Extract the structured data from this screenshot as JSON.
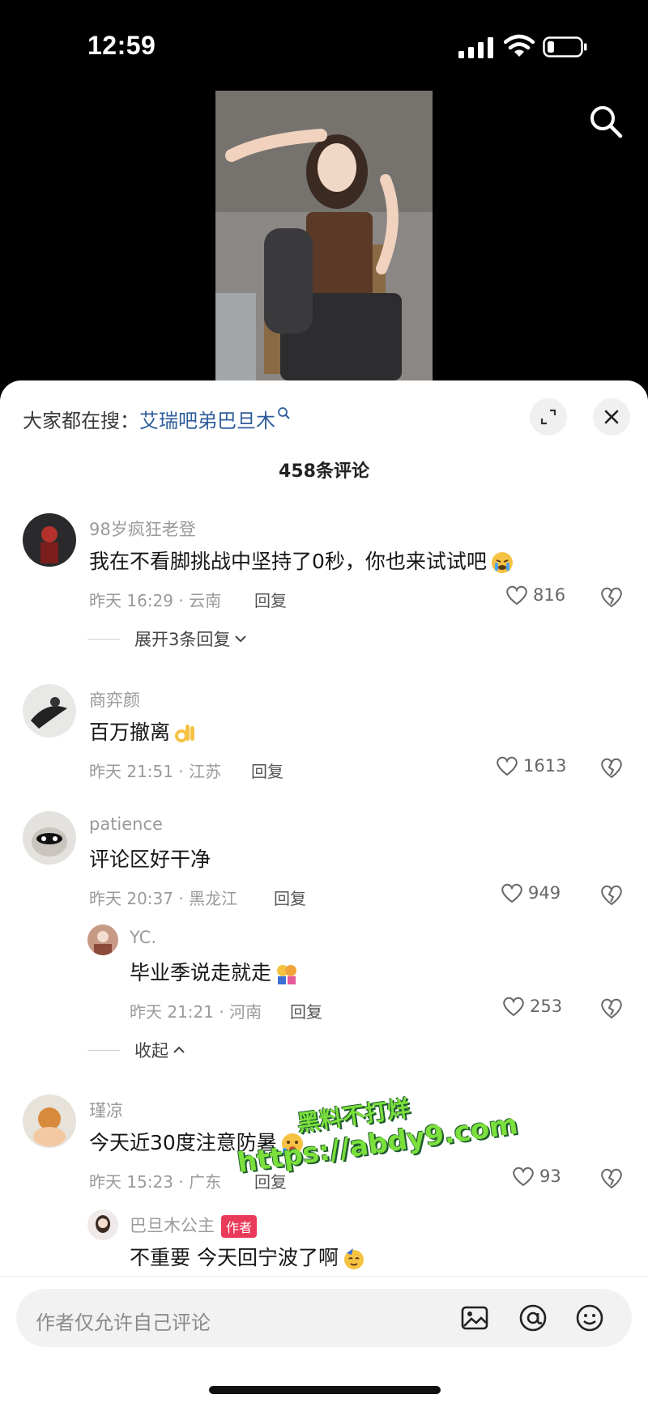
{
  "status": {
    "time": "12:59"
  },
  "sheet": {
    "trending_prefix": "大家都在搜：",
    "trending_keyword": "艾瑞吧弟巴旦木",
    "comment_count": "458条评论"
  },
  "comments": [
    {
      "name": "98岁疯狂老登",
      "text": "我在不看脚挑战中坚持了0秒，你也来试试吧",
      "time": "昨天 16:29 · 云南",
      "reply": "回复",
      "likes": "816",
      "expand": "展开3条回复"
    },
    {
      "name": "商弈颜",
      "text": "百万撤离",
      "time": "昨天 21:51 · 江苏",
      "reply": "回复",
      "likes": "1613"
    },
    {
      "name": "patience",
      "text": "评论区好干净",
      "time": "昨天 20:37 · 黑龙江",
      "reply": "回复",
      "likes": "949",
      "sub": {
        "name": "YC.",
        "text": "毕业季说走就走",
        "time": "昨天 21:21 · 河南",
        "reply": "回复",
        "likes": "253"
      },
      "collapse": "收起"
    },
    {
      "name": "瑾凉",
      "text": "今天近30度注意防暑",
      "time": "昨天 15:23 · 广东",
      "reply": "回复",
      "likes": "93",
      "sub": {
        "name": "巴旦木公主",
        "tag": "作者",
        "text": "不重要 今天回宁波了啊"
      }
    }
  ],
  "watermark": {
    "line1": "黑料不打烊",
    "line2": "https://abdy9.com"
  },
  "input": {
    "placeholder": "作者仅允许自己评论"
  },
  "icons": [
    "signal-icon",
    "wifi-icon",
    "battery-icon",
    "search-icon",
    "expand-icon",
    "close-icon",
    "heart-icon",
    "dislike-icon",
    "chevron-down-icon",
    "chevron-up-icon",
    "image-icon",
    "at-icon",
    "emoji-icon"
  ]
}
